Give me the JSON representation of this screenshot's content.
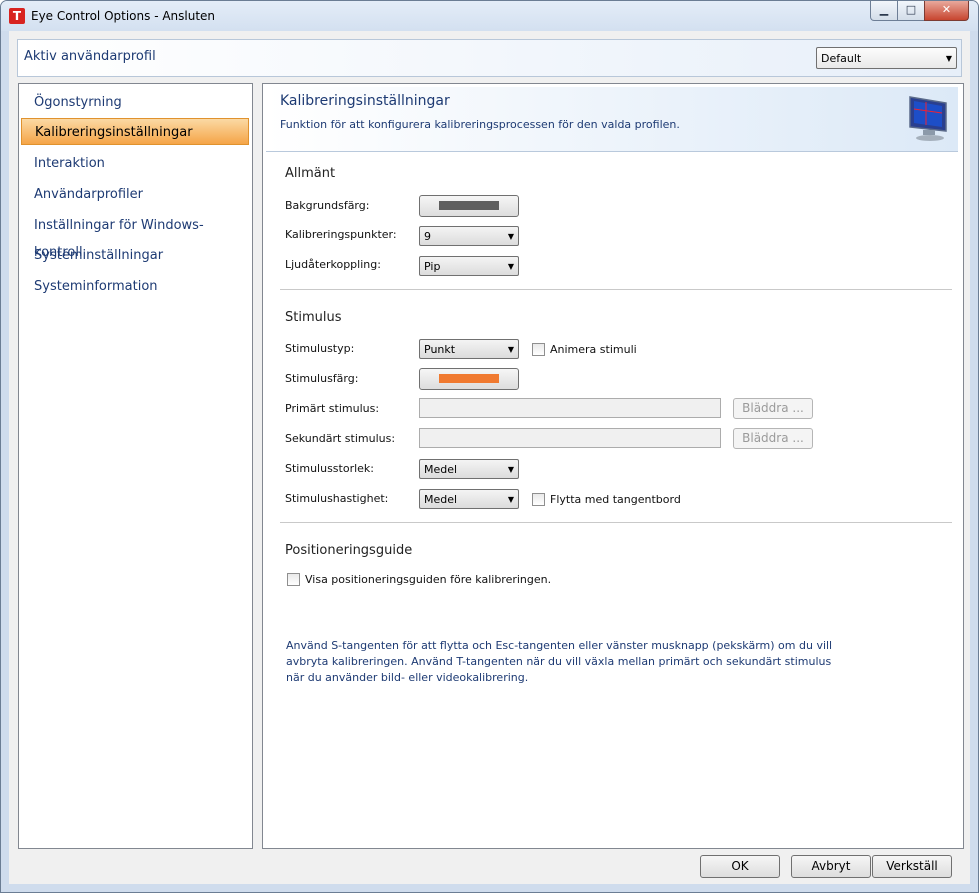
{
  "window": {
    "title": "Eye Control Options - Ansluten",
    "app_icon_letter": "T"
  },
  "profile": {
    "label": "Aktiv användarprofil",
    "selected": "Default"
  },
  "sidebar": {
    "items": [
      {
        "label": "Ögonstyrning"
      },
      {
        "label": "Kalibreringsinställningar"
      },
      {
        "label": "Interaktion"
      },
      {
        "label": "Användarprofiler"
      },
      {
        "label": "Inställningar för Windows-kontroll"
      },
      {
        "label": "Systeminställningar"
      },
      {
        "label": "Systeminformation"
      }
    ]
  },
  "header": {
    "title": "Kalibreringsinställningar",
    "description": "Funktion för att konfigurera kalibreringsprocessen för den valda profilen."
  },
  "general": {
    "title": "Allmänt",
    "background_color_label": "Bakgrundsfärg:",
    "background_color": "#5f5f5f",
    "points_label": "Kalibreringspunkter:",
    "points_value": "9",
    "audio_label": "Ljudåterkoppling:",
    "audio_value": "Pip"
  },
  "stimulus": {
    "title": "Stimulus",
    "type_label": "Stimulustyp:",
    "type_value": "Punkt",
    "animate_label": "Animera stimuli",
    "color_label": "Stimulusfärg:",
    "color": "#f07a30",
    "primary_label": "Primärt stimulus:",
    "secondary_label": "Sekundärt stimulus:",
    "browse_label": "Bläddra ...",
    "size_label": "Stimulusstorlek:",
    "size_value": "Medel",
    "speed_label": "Stimulushastighet:",
    "speed_value": "Medel",
    "keyboard_move_label": "Flytta med tangentbord"
  },
  "positioning": {
    "title": "Positioneringsguide",
    "show_label": "Visa positioneringsguiden före kalibreringen.",
    "info": "Använd S-tangenten för att flytta och Esc-tangenten eller vänster musknapp (pekskärm) om du vill avbryta kalibreringen. Använd T-tangenten när du vill växla mellan primärt och sekundärt stimulus när du använder bild- eller videokalibrering."
  },
  "footer": {
    "ok": "OK",
    "cancel": "Avbryt",
    "apply": "Verkställ"
  }
}
